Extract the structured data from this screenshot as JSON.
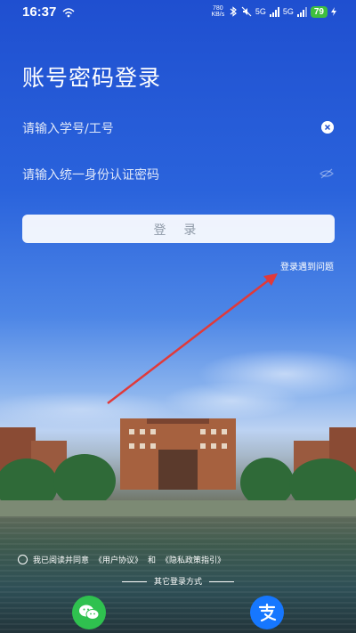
{
  "status_bar": {
    "time": "16:37",
    "net_speed_value": "780",
    "net_speed_unit": "KB/s",
    "sim1": "5G",
    "sim2": "5G",
    "battery": "79"
  },
  "title": "账号密码登录",
  "fields": {
    "account_placeholder": "请输入学号/工号",
    "password_placeholder": "请输入统一身份认证密码"
  },
  "login_button": "登 录",
  "help_link": "登录遇到问题",
  "agreement": {
    "prefix": "我已阅读并同意",
    "user_agreement": "《用户协议》",
    "and": "和",
    "privacy": "《隐私政策指引》"
  },
  "other_login": "其它登录方式",
  "colors": {
    "wechat": "#2fc14f",
    "alipay": "#1677ff",
    "annotation_arrow": "#e03a3a"
  },
  "icons": [
    "wifi-icon",
    "bluetooth-icon",
    "mute-icon",
    "signal-icon",
    "clear-icon",
    "eye-off-icon",
    "wechat-icon",
    "alipay-icon"
  ]
}
